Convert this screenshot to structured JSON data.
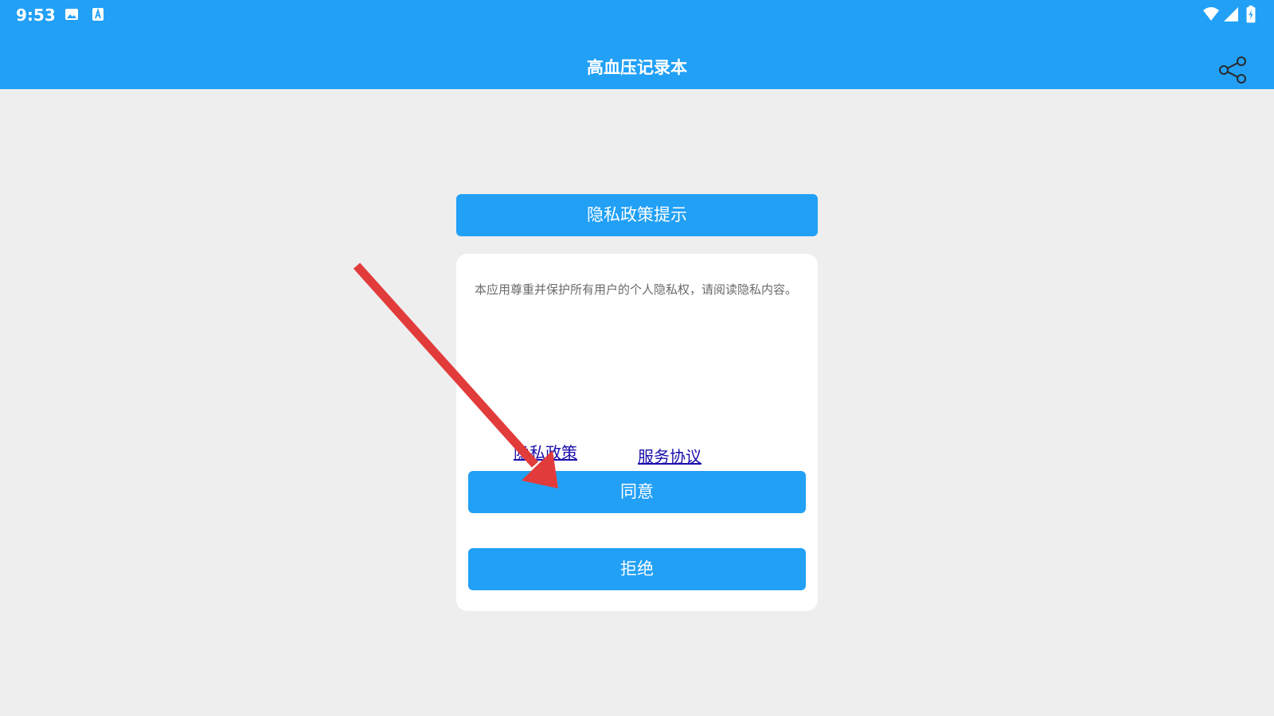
{
  "status_bar": {
    "time": "9:53",
    "icons": [
      "image-icon",
      "a-icon",
      "wifi-icon",
      "cell-signal-icon",
      "battery-icon"
    ]
  },
  "app_bar": {
    "title": "高血压记录本",
    "share_icon": "share-icon"
  },
  "dialog": {
    "title": "隐私政策提示",
    "body": "本应用尊重并保护所有用户的个人隐私权，请阅读隐私内容。",
    "privacy_link": "隐私政策",
    "service_link": "服务协议",
    "agree_label": "同意",
    "reject_label": "拒绝"
  },
  "colors": {
    "accent": "#21a0f6",
    "background": "#eeeeee",
    "link": "#1a0dab",
    "arrow": "#e23b3b"
  }
}
